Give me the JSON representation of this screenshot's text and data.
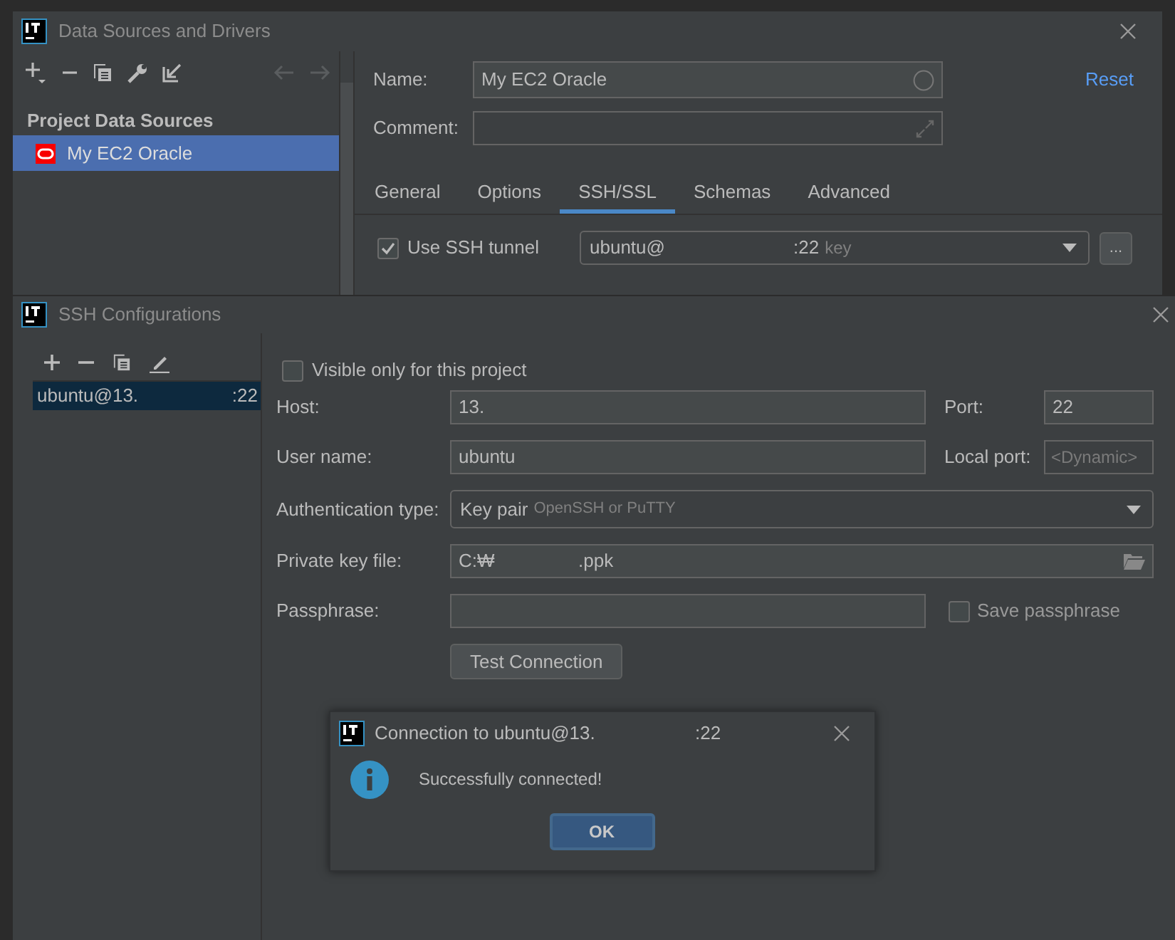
{
  "data_sources_window": {
    "title": "Data Sources and Drivers",
    "section_heading": "Project Data Sources",
    "items": [
      {
        "label": "My EC2 Oracle",
        "selected": true
      }
    ],
    "name": {
      "label": "Name:",
      "value": "My EC2 Oracle"
    },
    "comment": {
      "label": "Comment:"
    },
    "reset_link": "Reset",
    "tabs": [
      {
        "label": "General",
        "selected": false
      },
      {
        "label": "Options",
        "selected": false
      },
      {
        "label": "SSH/SSL",
        "selected": true
      },
      {
        "label": "Schemas",
        "selected": false
      },
      {
        "label": "Advanced",
        "selected": false
      }
    ],
    "ssh_tunnel": {
      "label": "Use SSH tunnel",
      "checked": true,
      "config_user": "ubuntu@",
      "config_port": ":22",
      "config_hint": "key",
      "more_button": "..."
    }
  },
  "ssh_window": {
    "title": "SSH Configurations",
    "configs": [
      {
        "host": "ubuntu@13.",
        "port": ":22",
        "selected": true
      }
    ],
    "visible_only": {
      "label": "Visible only for this project",
      "checked": false
    },
    "host": {
      "label": "Host:",
      "value": "13."
    },
    "port": {
      "label": "Port:",
      "value": "22"
    },
    "user_name": {
      "label": "User name:",
      "value": "ubuntu"
    },
    "local_port": {
      "label": "Local port:",
      "placeholder": "<Dynamic>"
    },
    "auth_type": {
      "label": "Authentication type:",
      "value": "Key pair",
      "hint": "OpenSSH or PuTTY"
    },
    "private_key": {
      "label": "Private key file:",
      "value_start": "C:₩",
      "value_end": ".ppk"
    },
    "passphrase": {
      "label": "Passphrase:"
    },
    "save_passphrase": {
      "label": "Save passphrase",
      "checked": false
    },
    "test_button": "Test Connection"
  },
  "dialog": {
    "title_start": "Connection to ubuntu@13.",
    "title_end": ":22",
    "message": "Successfully connected!",
    "ok_button": "OK"
  }
}
